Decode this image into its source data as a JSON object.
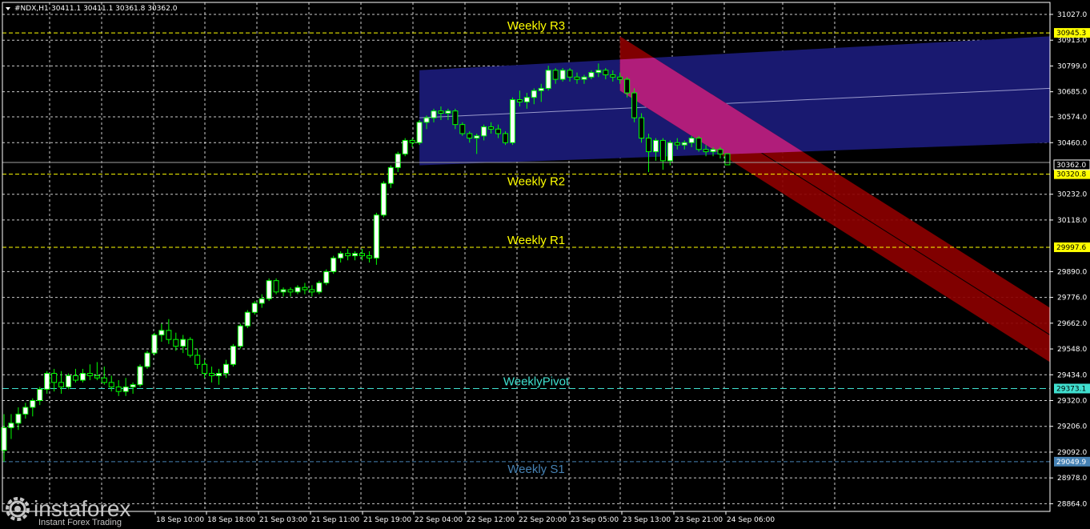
{
  "header": {
    "symbol": "#NDX,H1",
    "ohlc": "30411.1 30411.1 30361.8 30362.0"
  },
  "price_axis": {
    "ticks": [
      "31027.0",
      "30913.0",
      "30799.0",
      "30685.0",
      "30574.0",
      "30460.0",
      "30232.0",
      "30118.0",
      "29890.0",
      "29776.0",
      "29662.0",
      "29548.0",
      "29434.0",
      "29320.0",
      "29206.0",
      "29092.0",
      "28978.0",
      "28864.0"
    ],
    "current_price": "30362.0"
  },
  "time_axis": {
    "labels": [
      "18 Sep 10:00",
      "18 Sep 18:00",
      "21 Sep 03:00",
      "21 Sep 11:00",
      "21 Sep 19:00",
      "22 Sep 04:00",
      "22 Sep 12:00",
      "22 Sep 20:00",
      "23 Sep 05:00",
      "23 Sep 13:00",
      "23 Sep 21:00",
      "24 Sep 06:00"
    ]
  },
  "levels": [
    {
      "name": "Weekly R3",
      "value": "30945.3",
      "color": "#ffff00",
      "badge_bg": "#ffff00",
      "badge_fg": "#000000"
    },
    {
      "name": "Weekly R2",
      "value": "30320.8",
      "color": "#ffff00",
      "badge_bg": "#ffff00",
      "badge_fg": "#000000"
    },
    {
      "name": "Weekly R1",
      "value": "29997.6",
      "color": "#ffff00",
      "badge_bg": "#ffff00",
      "badge_fg": "#000000"
    },
    {
      "name": "WeeklyPivot",
      "value": "29373.1",
      "color": "#40e0d0",
      "badge_bg": "#40e0d0",
      "badge_fg": "#000000"
    },
    {
      "name": "Weekly S1",
      "value": "29049.9",
      "color": "#4682b4",
      "badge_bg": "#4682b4",
      "badge_fg": "#ffffff"
    }
  ],
  "logo": {
    "brand": "instaforex",
    "tagline": "Instant Forex Trading"
  },
  "chart_data": {
    "type": "candlestick",
    "symbol": "#NDX",
    "timeframe": "H1",
    "ylim": [
      28830,
      31080
    ],
    "colors": {
      "bull": "#ffffff",
      "bear": "#000000",
      "wick": "#00ff00",
      "background": "#000000",
      "grid": "#ffffff"
    },
    "candles": [
      [
        29100,
        29260,
        29050,
        29200
      ],
      [
        29200,
        29260,
        29150,
        29220
      ],
      [
        29220,
        29290,
        29190,
        29260
      ],
      [
        29260,
        29310,
        29240,
        29290
      ],
      [
        29290,
        29330,
        29250,
        29320
      ],
      [
        29320,
        29380,
        29300,
        29370
      ],
      [
        29370,
        29450,
        29350,
        29440
      ],
      [
        29440,
        29460,
        29360,
        29400
      ],
      [
        29400,
        29450,
        29350,
        29380
      ],
      [
        29380,
        29440,
        29370,
        29430
      ],
      [
        29430,
        29460,
        29400,
        29410
      ],
      [
        29410,
        29460,
        29400,
        29440
      ],
      [
        29440,
        29480,
        29410,
        29430
      ],
      [
        29430,
        29490,
        29410,
        29420
      ],
      [
        29420,
        29470,
        29390,
        29400
      ],
      [
        29400,
        29430,
        29360,
        29380
      ],
      [
        29380,
        29410,
        29340,
        29360
      ],
      [
        29360,
        29420,
        29340,
        29380
      ],
      [
        29380,
        29400,
        29350,
        29390
      ],
      [
        29390,
        29480,
        29380,
        29470
      ],
      [
        29470,
        29540,
        29460,
        29530
      ],
      [
        29530,
        29620,
        29520,
        29610
      ],
      [
        29610,
        29660,
        29580,
        29630
      ],
      [
        29630,
        29680,
        29570,
        29590
      ],
      [
        29590,
        29620,
        29540,
        29560
      ],
      [
        29560,
        29610,
        29530,
        29590
      ],
      [
        29590,
        29600,
        29510,
        29520
      ],
      [
        29520,
        29550,
        29460,
        29480
      ],
      [
        29480,
        29500,
        29420,
        29440
      ],
      [
        29440,
        29470,
        29400,
        29430
      ],
      [
        29430,
        29460,
        29390,
        29440
      ],
      [
        29440,
        29500,
        29420,
        29480
      ],
      [
        29480,
        29570,
        29470,
        29560
      ],
      [
        29560,
        29660,
        29550,
        29650
      ],
      [
        29650,
        29720,
        29640,
        29710
      ],
      [
        29710,
        29760,
        29700,
        29750
      ],
      [
        29750,
        29790,
        29730,
        29770
      ],
      [
        29770,
        29860,
        29760,
        29850
      ],
      [
        29850,
        29860,
        29790,
        29800
      ],
      [
        29800,
        29820,
        29780,
        29810
      ],
      [
        29810,
        29820,
        29780,
        29800
      ],
      [
        29800,
        29830,
        29790,
        29820
      ],
      [
        29820,
        29840,
        29790,
        29810
      ],
      [
        29810,
        29830,
        29780,
        29800
      ],
      [
        29800,
        29850,
        29790,
        29840
      ],
      [
        29840,
        29900,
        29830,
        29890
      ],
      [
        29890,
        29960,
        29880,
        29950
      ],
      [
        29950,
        29980,
        29930,
        29970
      ],
      [
        29970,
        29990,
        29940,
        29960
      ],
      [
        29960,
        29980,
        29940,
        29970
      ],
      [
        29970,
        29990,
        29940,
        29960
      ],
      [
        29960,
        29980,
        29930,
        29950
      ],
      [
        29950,
        30150,
        29920,
        30140
      ],
      [
        30140,
        30290,
        30130,
        30280
      ],
      [
        30280,
        30360,
        30260,
        30350
      ],
      [
        30350,
        30420,
        30330,
        30410
      ],
      [
        30410,
        30480,
        30400,
        30470
      ],
      [
        30470,
        30480,
        30440,
        30460
      ],
      [
        30460,
        30560,
        30450,
        30550
      ],
      [
        30550,
        30580,
        30520,
        30570
      ],
      [
        30570,
        30610,
        30550,
        30600
      ],
      [
        30600,
        30620,
        30560,
        30590
      ],
      [
        30590,
        30610,
        30560,
        30600
      ],
      [
        30600,
        30610,
        30520,
        30540
      ],
      [
        30540,
        30550,
        30490,
        30500
      ],
      [
        30500,
        30510,
        30460,
        30480
      ],
      [
        30480,
        30500,
        30410,
        30490
      ],
      [
        30490,
        30540,
        30470,
        30530
      ],
      [
        30530,
        30550,
        30500,
        30520
      ],
      [
        30520,
        30540,
        30480,
        30500
      ],
      [
        30500,
        30510,
        30450,
        30460
      ],
      [
        30460,
        30660,
        30450,
        30650
      ],
      [
        30650,
        30690,
        30620,
        30640
      ],
      [
        30640,
        30680,
        30610,
        30660
      ],
      [
        30660,
        30700,
        30630,
        30690
      ],
      [
        30690,
        30720,
        30640,
        30700
      ],
      [
        30700,
        30800,
        30690,
        30780
      ],
      [
        30780,
        30790,
        30720,
        30740
      ],
      [
        30740,
        30790,
        30730,
        30780
      ],
      [
        30780,
        30790,
        30730,
        30750
      ],
      [
        30750,
        30770,
        30720,
        30740
      ],
      [
        30740,
        30760,
        30720,
        30750
      ],
      [
        30750,
        30780,
        30740,
        30770
      ],
      [
        30770,
        30810,
        30750,
        30780
      ],
      [
        30780,
        30790,
        30740,
        30760
      ],
      [
        30760,
        30780,
        30730,
        30750
      ],
      [
        30750,
        30770,
        30720,
        30740
      ],
      [
        30740,
        30750,
        30660,
        30680
      ],
      [
        30680,
        30700,
        30550,
        30570
      ],
      [
        30570,
        30590,
        30460,
        30480
      ],
      [
        30480,
        30500,
        30330,
        30420
      ],
      [
        30420,
        30480,
        30380,
        30470
      ],
      [
        30470,
        30480,
        30340,
        30380
      ],
      [
        30380,
        30470,
        30360,
        30460
      ],
      [
        30460,
        30480,
        30430,
        30450
      ],
      [
        30450,
        30470,
        30430,
        30460
      ],
      [
        30460,
        30490,
        30440,
        30480
      ],
      [
        30480,
        30490,
        30420,
        30430
      ],
      [
        30430,
        30450,
        30400,
        30420
      ],
      [
        30420,
        30440,
        30400,
        30430
      ],
      [
        30430,
        30440,
        30390,
        30410
      ],
      [
        30411.1,
        30411.1,
        30361.8,
        30362.0
      ]
    ],
    "levels": [
      {
        "name": "Weekly R3",
        "value": 30945.3
      },
      {
        "name": "Weekly R2",
        "value": 30320.8
      },
      {
        "name": "Weekly R1",
        "value": 29997.6
      },
      {
        "name": "WeeklyPivot",
        "value": 29373.1
      },
      {
        "name": "Weekly S1",
        "value": 29049.9
      }
    ],
    "regression_channels": [
      {
        "color": "#191970",
        "start_index": 58,
        "start": [
          30570,
          30360,
          30780
        ],
        "end": [
          30700,
          30460,
          30930
        ]
      },
      {
        "color": "#8b0000",
        "start_index": 86,
        "start": [
          30810,
          30690,
          30930
        ],
        "end": [
          29610,
          29490,
          29730
        ]
      }
    ]
  }
}
